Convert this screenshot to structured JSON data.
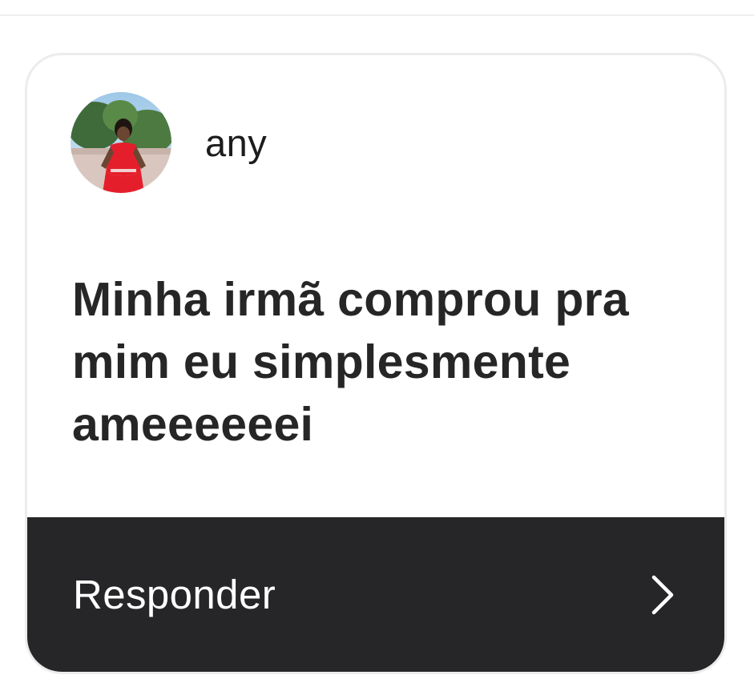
{
  "card": {
    "username": "any",
    "message": "Minha irmã comprou pra mim eu simplesmente ameeeeeei",
    "reply_label": "Responder"
  },
  "icons": {
    "avatar": "profile-photo",
    "reply": "chevron-right-icon"
  },
  "colors": {
    "reply_bar_background": "#262629",
    "reply_text": "#ffffff",
    "message_text": "#262626",
    "card_border": "#ececec"
  }
}
